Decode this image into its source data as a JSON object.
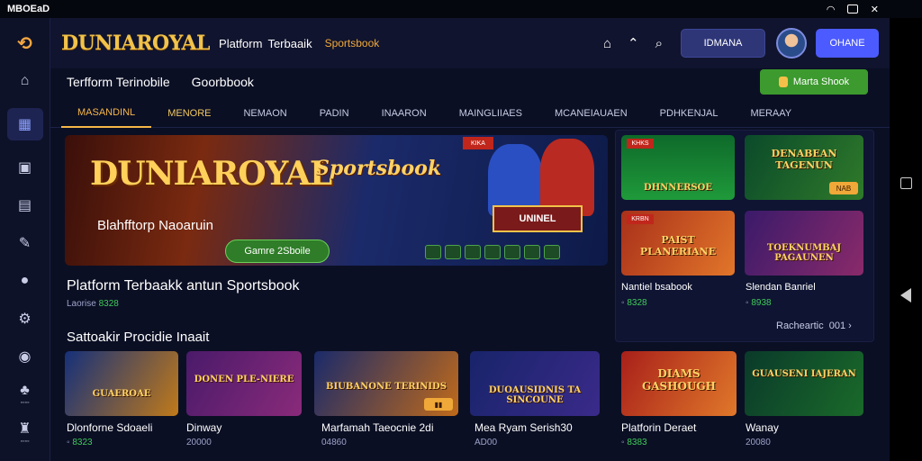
{
  "status": {
    "left": "MBOEaD"
  },
  "header": {
    "brand": "DUNIAROYAL",
    "link1": "Platform",
    "link2": "Terbaaik",
    "link3": "Sportsbook",
    "login": "IDMANA",
    "register": "OHANE"
  },
  "subbar": {
    "t1": "Terfform Terinobile",
    "t2": "Goorbbook",
    "shop": "Marta Shook"
  },
  "tabs": [
    "MASANDINL",
    "MENORE",
    "NEMAON",
    "PADIN",
    "INAARON",
    "MAINGLIIAES",
    "MCANEIAUAEN",
    "PDHKENJAL",
    "MERAAY"
  ],
  "hero": {
    "brand": "DUNIAROYAL",
    "sub": "Sportsbook",
    "tagline": "Blahfftorp Naoaruin",
    "cta": "Gamre 2Sboile",
    "badge": "UNINEL",
    "chip": "KIKA"
  },
  "main": {
    "title": "Platform Terbaakk antun Sportsbook",
    "meta_label": "Laorise",
    "meta_value": "8328",
    "section2": "Sattoakir Procidie Inaait"
  },
  "right": {
    "c1_title": "DHNNERSOE",
    "c2_title": "DENABEAN TAGENUN",
    "c3_title": "PAIST PLANERIANE",
    "c4_title": "TOEKNUMBAJ PAGAUNEN",
    "c1_chip": "KHKS",
    "c3_chip": "KRBN",
    "c2_badge": "NAB",
    "label1": "Nantiel bsabook",
    "value1": "8328",
    "label2": "Slendan Banriel",
    "value2": "8938",
    "more": "Racheartic",
    "more_count": "001"
  },
  "grid": [
    {
      "title": "GUAEROAE",
      "label": "Dlonforne Sdoaeli",
      "meta": "8323"
    },
    {
      "title": "DONEN PLE-NIERE",
      "label": "Dinway",
      "meta": "20000"
    },
    {
      "title": "BIUBANONE TERINIDS",
      "label": "Marfamah Taeocnie 2di",
      "meta": "04860"
    },
    {
      "title": "DUOAUSIDNIS TA SINCOUNE",
      "label": "Mea Ryam Serish30",
      "meta": "AD00"
    },
    {
      "title": "DIAMS GASHOUGH",
      "label": "Platforin Deraet",
      "meta": "8383"
    },
    {
      "title": "GUAUSENI IAJERAN",
      "label": "Wanay",
      "meta": "20080"
    }
  ]
}
